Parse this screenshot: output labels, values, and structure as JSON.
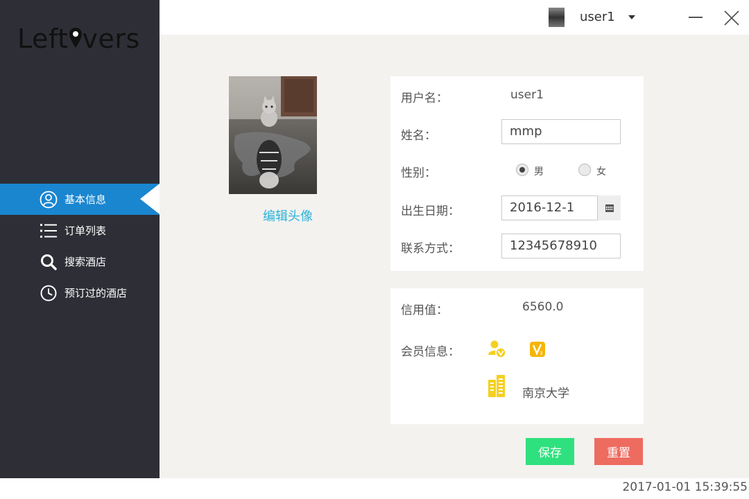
{
  "app": {
    "logo_text_left": "Left",
    "logo_text_right": "vers"
  },
  "sidebar": {
    "items": [
      {
        "label": "基本信息",
        "icon": "user-circle-icon",
        "active": true
      },
      {
        "label": "订单列表",
        "icon": "list-icon",
        "active": false
      },
      {
        "label": "搜索酒店",
        "icon": "search-icon",
        "active": false
      },
      {
        "label": "预订过的酒店",
        "icon": "clock-icon",
        "active": false
      }
    ]
  },
  "topbar": {
    "username": "user1"
  },
  "profile": {
    "edit_avatar_label": "编辑头像",
    "username_label": "用户名：",
    "username_value": "user1",
    "name_label": "姓名：",
    "name_value": "mmp",
    "gender_label": "性别：",
    "gender_male": "男",
    "gender_female": "女",
    "birthday_label": "出生日期：",
    "birthday_value": "2016-12-1",
    "contact_label": "联系方式：",
    "contact_value": "12345678910"
  },
  "member": {
    "credit_label": "信用值：",
    "credit_value": "6560.0",
    "member_label": "会员信息：",
    "school": "南京大学"
  },
  "buttons": {
    "save": "保存",
    "reset": "重置"
  },
  "footer": {
    "datetime": "2017-01-01 15:39:55"
  },
  "colors": {
    "sidebar_bg": "#2e2f36",
    "active": "#1a86d0",
    "save": "#2fe17e",
    "reset": "#ee6b60",
    "link": "#2cb3d9",
    "badge": "#f5c518"
  }
}
